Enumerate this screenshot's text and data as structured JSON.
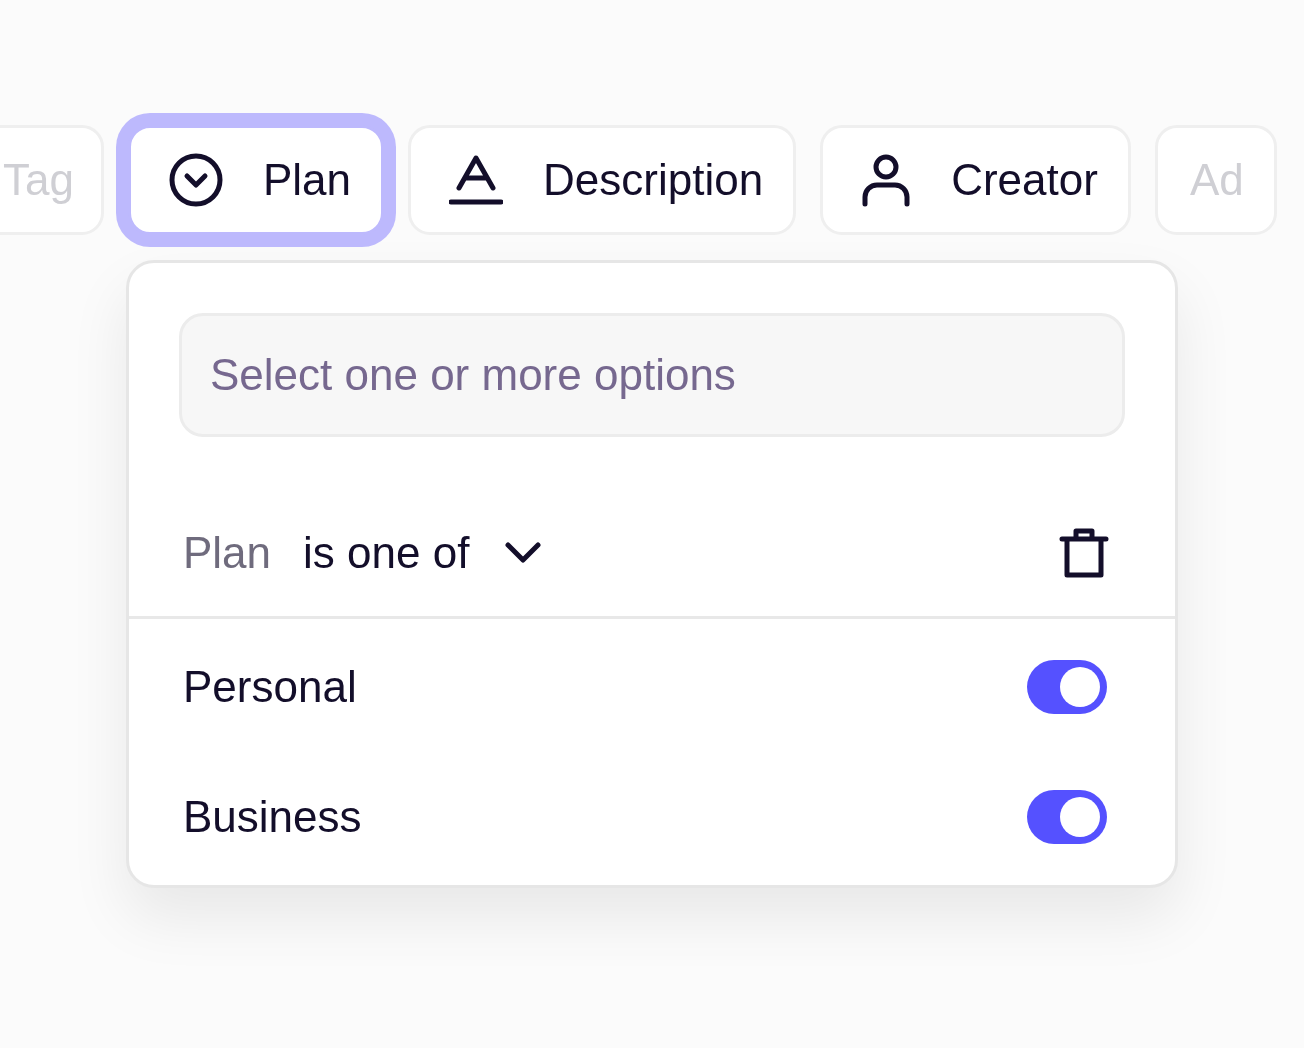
{
  "chips": [
    {
      "label": "Tag",
      "kind": "plain",
      "faded": true,
      "selected": false
    },
    {
      "label": "Plan",
      "kind": "option",
      "faded": false,
      "selected": true
    },
    {
      "label": "Description",
      "kind": "text",
      "faded": false,
      "selected": false
    },
    {
      "label": "Creator",
      "kind": "person",
      "faded": false,
      "selected": false
    },
    {
      "label": "Ad",
      "kind": "plain",
      "faded": true,
      "selected": false
    }
  ],
  "panel": {
    "search": {
      "placeholder": "Select one or more options"
    },
    "filter": {
      "field": "Plan",
      "operator": "is one of"
    },
    "options": [
      {
        "label": "Personal",
        "on": true
      },
      {
        "label": "Business",
        "on": true
      }
    ]
  }
}
